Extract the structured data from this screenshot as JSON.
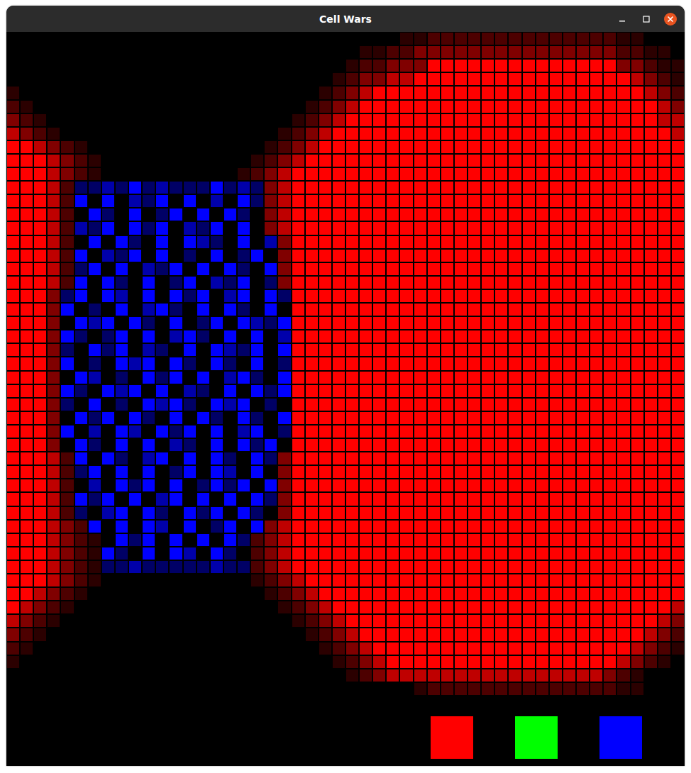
{
  "window": {
    "title": "Cell Wars"
  },
  "board": {
    "columns": 50,
    "cell_codes": [
      {
        "code": "0",
        "team": "none",
        "level": 0
      },
      {
        "code": "1",
        "team": "red",
        "level": 0.17
      },
      {
        "code": "2",
        "team": "red",
        "level": 0.3
      },
      {
        "code": "3",
        "team": "red",
        "level": 0.5
      },
      {
        "code": "4",
        "team": "red",
        "level": 0.75
      },
      {
        "code": "5",
        "team": "red",
        "level": 1
      },
      {
        "code": "A",
        "team": "blue",
        "level": 0.4
      },
      {
        "code": "B",
        "team": "blue",
        "level": 0.67
      },
      {
        "code": "C",
        "team": "blue",
        "level": 1
      }
    ],
    "rows": [
      "00000000000000000000000000000112222222222222211000",
      "00000000000000000000000000112233333333333333322110",
      "00000000000000000000000001223335555555555555533211",
      "00000000000000000000000012334455555555555555554321",
      "10000000000000000000000123455555555555555555555432",
      "21000000000000000000001234555555555555555555555543",
      "32100000000000000000012345555555555555555555555544",
      "43210000000000000000123455555555555555555555555554",
      "55432100000000000001234555555555555555555555555555",
      "55543210000000000012345555555555555555555555555555",
      "55543210000000000123455555555555555555555555555555",
      "55542AABACABAAACABA3455555555555555555555555555555",
      "55542C0C0BAC0C0B0CA3455555555555555555555555555555",
      "555420CA0C0AC0C0CA03455555555555555555555555555555",
      "55542BAC0CAC0BAC0C03455555555555555555555555555555",
      "555420C0CA0C0CBA0C0B355555555555555555555555555555",
      "55542C0BAC0C0A0C0AC0355555555555555555555555555555",
      "55542AC0C0BAC0C0CA0C355555555555555555555555555555",
      "55542C0CA0C0AC0BAC0A355555555555555555555555555555",
      "5553AC0CB0C0CAC0BC0CA55555555555555555555555555555",
      "5553C0A0C0BCA0C0CA0C055555555555555555555555555555",
      "55530CBC0CA0C0AC0CBAC55555555555555555555555555555",
      "5553CA0AC0C0BCA0C0C0B55555555555555555555555555555",
      "5553A0CAC0BA0C0CBAC0C55555555555555555555555555555",
      "5553C0A0CBC0CA0CA0C0A55555555555555555555555555555",
      "55530CB0A0CAC0C0BCA0C55555555555555555555555555555",
      "5553CA0CBC0C0BA0C0CAC55555555555555555555555555555",
      "5553A0C0A0CBCA0CBC0A055555555555555555555555555555",
      "55530CAC0CA0C0CA0CA0C55555555555555555555555555555",
      "5553C0B0CB0CAC0C0BC0A55555555555555555555555555555",
      "55530CA0C0C0BA0C0CAC055555555555555555555555555555",
      "55542C0CA0BC0C0CA0CA355555555555555555555555555555",
      "55542AC0C0C0AC0CB0C0355555555555555555555555555555",
      "555420B0CAC0C0ACAC0C355555555555555555555555555555",
      "55542CAC0C0BC0C0C0CA355555555555555555555555555555",
      "55542A0BC0CA0CAC0CA0355555555555555555555555555555",
      "555432C0C0CB0C0AC0C3455555555555555555555555555555",
      "55543210CAC0C0C0CA23455555555555555555555555555555",
      "5554321CA0C0CB0CA023455555555555555555555555555555",
      "5554321AABAAAAABAA23455555555555555555555555555555",
      "55543210000000000012345555555555555555555555555555",
      "55432100000000000001234555555555555555555555555555",
      "54321000000000000000123455555555555555555555555554",
      "43210000000000000000012345555555555555555555555543",
      "32100000000000000000001234555555555555555555555432",
      "21000000000000000000000123455555555555555555554321",
      "10000000000000000000000012345555555555555555543210",
      "00000000000000000000000001234444444444444444321000",
      "00000000000000000000000000000012222222222222211000",
      "00000000000000000000000000000000000000000000000000"
    ]
  },
  "teams": [
    {
      "name": "red",
      "color": "#ff0000"
    },
    {
      "name": "green",
      "color": "#00ff00"
    },
    {
      "name": "blue",
      "color": "#0000ff"
    }
  ]
}
